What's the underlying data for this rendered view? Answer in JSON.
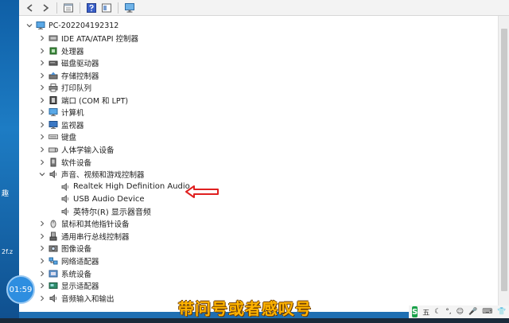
{
  "desktop": {
    "fragments": [
      "趣",
      "2f.z"
    ]
  },
  "tree": {
    "root": "PC-202204192312",
    "categories": [
      {
        "label": "IDE ATA/ATAPI 控制器",
        "icon": "ide-controller-icon"
      },
      {
        "label": "处理器",
        "icon": "processor-icon"
      },
      {
        "label": "磁盘驱动器",
        "icon": "disk-drive-icon"
      },
      {
        "label": "存储控制器",
        "icon": "storage-controller-icon"
      },
      {
        "label": "打印队列",
        "icon": "printer-icon"
      },
      {
        "label": "端口 (COM 和 LPT)",
        "icon": "port-icon"
      },
      {
        "label": "计算机",
        "icon": "computer-icon"
      },
      {
        "label": "监视器",
        "icon": "monitor-icon"
      },
      {
        "label": "键盘",
        "icon": "keyboard-icon"
      },
      {
        "label": "人体学输入设备",
        "icon": "hid-icon"
      },
      {
        "label": "软件设备",
        "icon": "software-device-icon"
      },
      {
        "label": "声音、视频和游戏控制器",
        "icon": "speaker-icon",
        "expanded": true,
        "children": [
          "Realtek High Definition Audio",
          "USB Audio Device",
          "英特尔(R) 显示器音频"
        ]
      },
      {
        "label": "鼠标和其他指针设备",
        "icon": "mouse-icon"
      },
      {
        "label": "通用串行总线控制器",
        "icon": "usb-controller-icon"
      },
      {
        "label": "图像设备",
        "icon": "camera-icon"
      },
      {
        "label": "网络适配器",
        "icon": "network-adapter-icon"
      },
      {
        "label": "系统设备",
        "icon": "system-device-icon"
      },
      {
        "label": "显示适配器",
        "icon": "display-adapter-icon"
      },
      {
        "label": "音频输入和输出",
        "icon": "audio-io-icon"
      }
    ]
  },
  "overlay": {
    "timer": "01:59",
    "caption": "带问号或者感叹号"
  },
  "tray": {
    "ime": "五"
  },
  "colors": {
    "caption": "#ffb400",
    "arrow": "#e02020",
    "timer": "#2e8ee0",
    "desktop": "#1f6fb2"
  }
}
